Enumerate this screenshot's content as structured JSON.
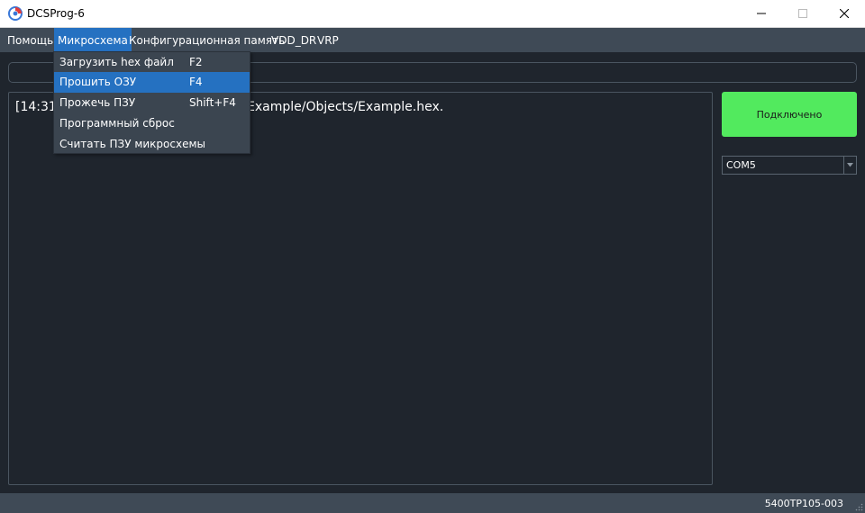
{
  "window": {
    "title": "DCSProg-6"
  },
  "menubar": {
    "items": [
      {
        "label": "Помощь"
      },
      {
        "label": "Микросхема"
      },
      {
        "label": "Конфигурационная память"
      },
      {
        "label": "VDD_DR"
      },
      {
        "label": "VRP"
      }
    ],
    "active_index": 1
  },
  "dropdown": {
    "items": [
      {
        "label": "Загрузить hex файл",
        "shortcut": "F2"
      },
      {
        "label": "Прошить ОЗУ",
        "shortcut": "F4"
      },
      {
        "label": "Прожечь ПЗУ",
        "shortcut": "Shift+F4"
      },
      {
        "label": "Программный сброс",
        "shortcut": ""
      },
      {
        "label": "Считать ПЗУ микросхемы",
        "shortcut": ""
      }
    ],
    "highlighted_index": 1
  },
  "path_field": {
    "value": ""
  },
  "log": {
    "lines": [
      "[14:31",
      "Example/Objects/Example.hex."
    ]
  },
  "connection": {
    "button_label": "Подключено",
    "status_color": "#52ea5e"
  },
  "port_select": {
    "value": "COM5"
  },
  "statusbar": {
    "text": "5400ТР105-003"
  },
  "colors": {
    "accent": "#2571c1",
    "background": "#1f252d",
    "bar": "#3f4a56"
  }
}
